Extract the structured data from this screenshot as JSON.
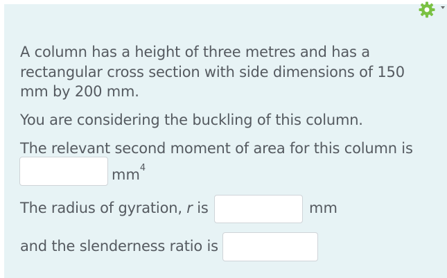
{
  "question": {
    "line1": "A column has a height of three metres and has a",
    "line2": "rectangular cross section with side dimensions of 150",
    "line3": "mm by 200 mm.",
    "line4": "You are considering the buckling of this column.",
    "line5": "The relevant second moment of area for this column is",
    "unit1_base": "mm",
    "unit1_exp": "4",
    "line6_prefix": "The radius of gyration, ",
    "line6_var": "r",
    "line6_suffix": " is",
    "unit2": "mm",
    "line7": "and the slenderness ratio is"
  },
  "inputs": {
    "second_moment_value": "",
    "radius_value": "",
    "slenderness_value": ""
  },
  "toolbar": {
    "settings_icon": "gear-icon",
    "accent_color": "#7ac143"
  },
  "colors": {
    "panel_background": "#e7f3f5",
    "text": "#555a60"
  }
}
